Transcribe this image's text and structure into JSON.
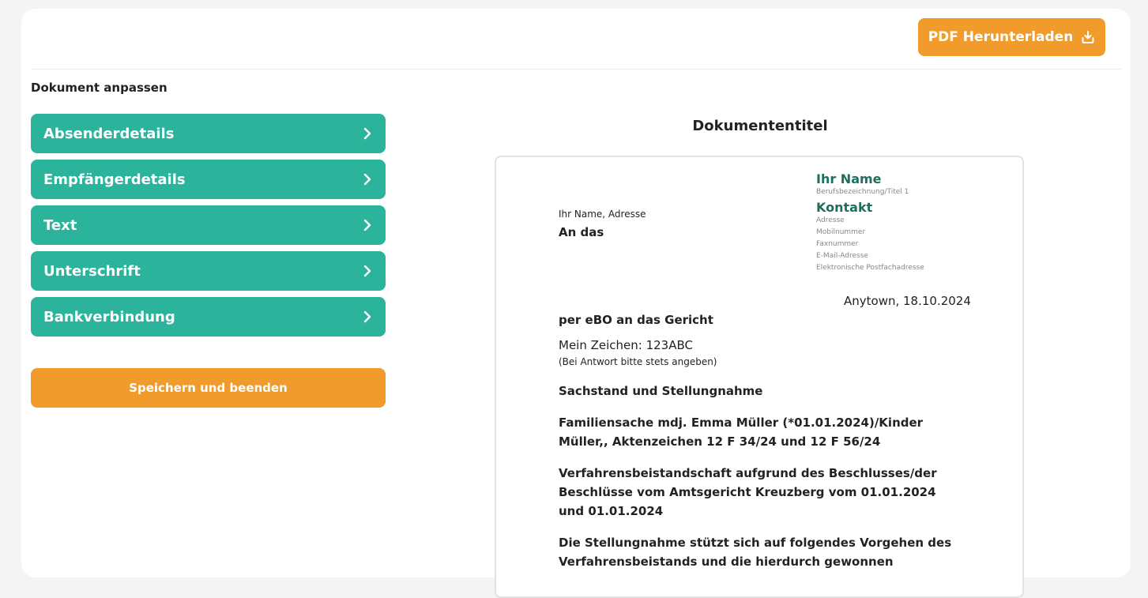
{
  "toolbar": {
    "pdf_label": "PDF Herunterladen",
    "pdf_icon": "download-icon"
  },
  "sidebar": {
    "section_label": "Dokument anpassen",
    "items": [
      {
        "label": "Absenderdetails"
      },
      {
        "label": "Empfängerdetails"
      },
      {
        "label": "Text"
      },
      {
        "label": "Unterschrift"
      },
      {
        "label": "Bankverbindung"
      }
    ],
    "save_label": "Speichern und beenden"
  },
  "preview": {
    "title": "Dokumententitel",
    "sender_line": "Ihr Name, Adresse",
    "recipient_heading": "An das",
    "right_block": {
      "name": "Ihr Name",
      "job_title": "Berufsbezeichnung/Titel 1",
      "contact_heading": "Kontakt",
      "address": "Adresse",
      "mobile": "Mobilnummer",
      "fax": "Faxnummer",
      "email": "E-Mail-Adresse",
      "postbox": "Elektronische Postfachadresse"
    },
    "date_line": "Anytown, 18.10.2024",
    "ebo_line": "per eBO an das Gericht",
    "reference": "Mein Zeichen: 123ABC",
    "reference_hint": "(Bei Antwort bitte stets angeben)",
    "subject": "Sachstand und Stellungnahme",
    "case_line": "Familiensache mdj. Emma Müller (*01.01.2024)/Kinder Müller,, Aktenzeichen 12 F 34/24 und 12 F 56/24",
    "procedure_line": "Verfahrensbeistandschaft aufgrund des Beschlusses/der Beschlüsse vom Amtsgericht Kreuzberg vom 01.01.2024 und 01.01.2024",
    "statement_line": "Die Stellungnahme stützt sich auf folgendes Vorgehen des Verfahrensbeistands und die hierdurch gewonnen"
  },
  "colors": {
    "accent_green": "#2bb39b",
    "accent_orange": "#f19b2c",
    "heading_green": "#1e6e5c"
  }
}
